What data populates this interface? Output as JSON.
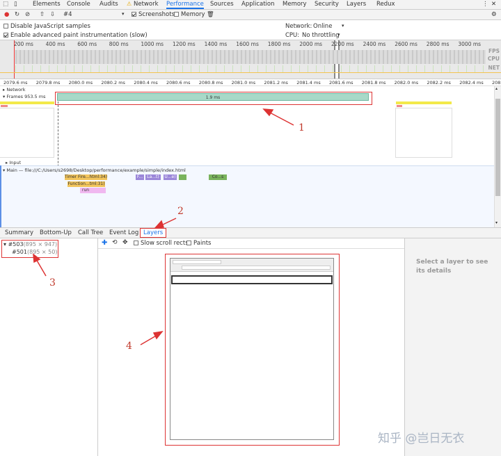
{
  "tabs": {
    "items": [
      "Elements",
      "Console",
      "Audits",
      "Network",
      "Performance",
      "Sources",
      "Application",
      "Memory",
      "Security",
      "Layers",
      "Redux"
    ],
    "warning_glyph": "⚠",
    "more": "⋮",
    "close": "✕"
  },
  "toolbar": {
    "profile": "#4",
    "screenshots_label": "Screenshots",
    "memory_label": "Memory"
  },
  "settings": {
    "disable_js_samples": "Disable JavaScript samples",
    "advanced_paint": "Enable advanced paint instrumentation (slow)",
    "network_label": "Network:",
    "network_value": "Online",
    "cpu_label": "CPU:",
    "cpu_value": "No throttling"
  },
  "overview": {
    "ticks": [
      "200 ms",
      "400 ms",
      "600 ms",
      "800 ms",
      "1000 ms",
      "1200 ms",
      "1400 ms",
      "1600 ms",
      "1800 ms",
      "2000 ms",
      "2200 ms",
      "2400 ms",
      "2600 ms",
      "2800 ms",
      "3000 ms"
    ],
    "labels": [
      "FPS",
      "CPU",
      "NET"
    ]
  },
  "ruler": {
    "ticks": [
      "2079.6 ms",
      "2079.8 ms",
      "2080.0 ms",
      "2080.2 ms",
      "2080.4 ms",
      "2080.6 ms",
      "2080.8 ms",
      "2081.0 ms",
      "2081.2 ms",
      "2081.4 ms",
      "2081.6 ms",
      "2081.8 ms",
      "2082.0 ms",
      "2082.2 ms",
      "2082.4 ms",
      "208"
    ]
  },
  "flame": {
    "network_track": "Network",
    "frames_track": "Frames",
    "frames_value": "953.5 ms",
    "frame_bar_label": "1.9 ms",
    "input_track": "Input",
    "main_track": "Main — file:///C:/Users/s2698/Desktop/performance/example/simple/index.html",
    "blocks": [
      "Timer Fire...html:34)",
      "Function...tml:31)",
      "run",
      "F...",
      "La...t)",
      "U...e)",
      "Co...s"
    ]
  },
  "bottom_tabs": [
    "Summary",
    "Bottom-Up",
    "Call Tree",
    "Event Log",
    "Layers"
  ],
  "layers": {
    "tree": [
      {
        "id": "#503",
        "size": "(895 × 947)"
      },
      {
        "id": "#501",
        "size": "(895 × 50)"
      }
    ],
    "slow_scroll": "Slow scroll rects",
    "paints": "Paints",
    "details_hint": "Select a layer to see its details"
  },
  "annotations": [
    "1",
    "2",
    "3",
    "4"
  ],
  "watermark": "知乎 @岂日无衣",
  "colors": {
    "active_tab": "#1a73e8",
    "annotation_red": "#d33",
    "frame_green": "#a8d9c8",
    "timer_yellow": "#f2c55c",
    "run_pink": "#f0b8f0",
    "layout_purple": "#9b87d9",
    "paint_green": "#79b35c"
  }
}
